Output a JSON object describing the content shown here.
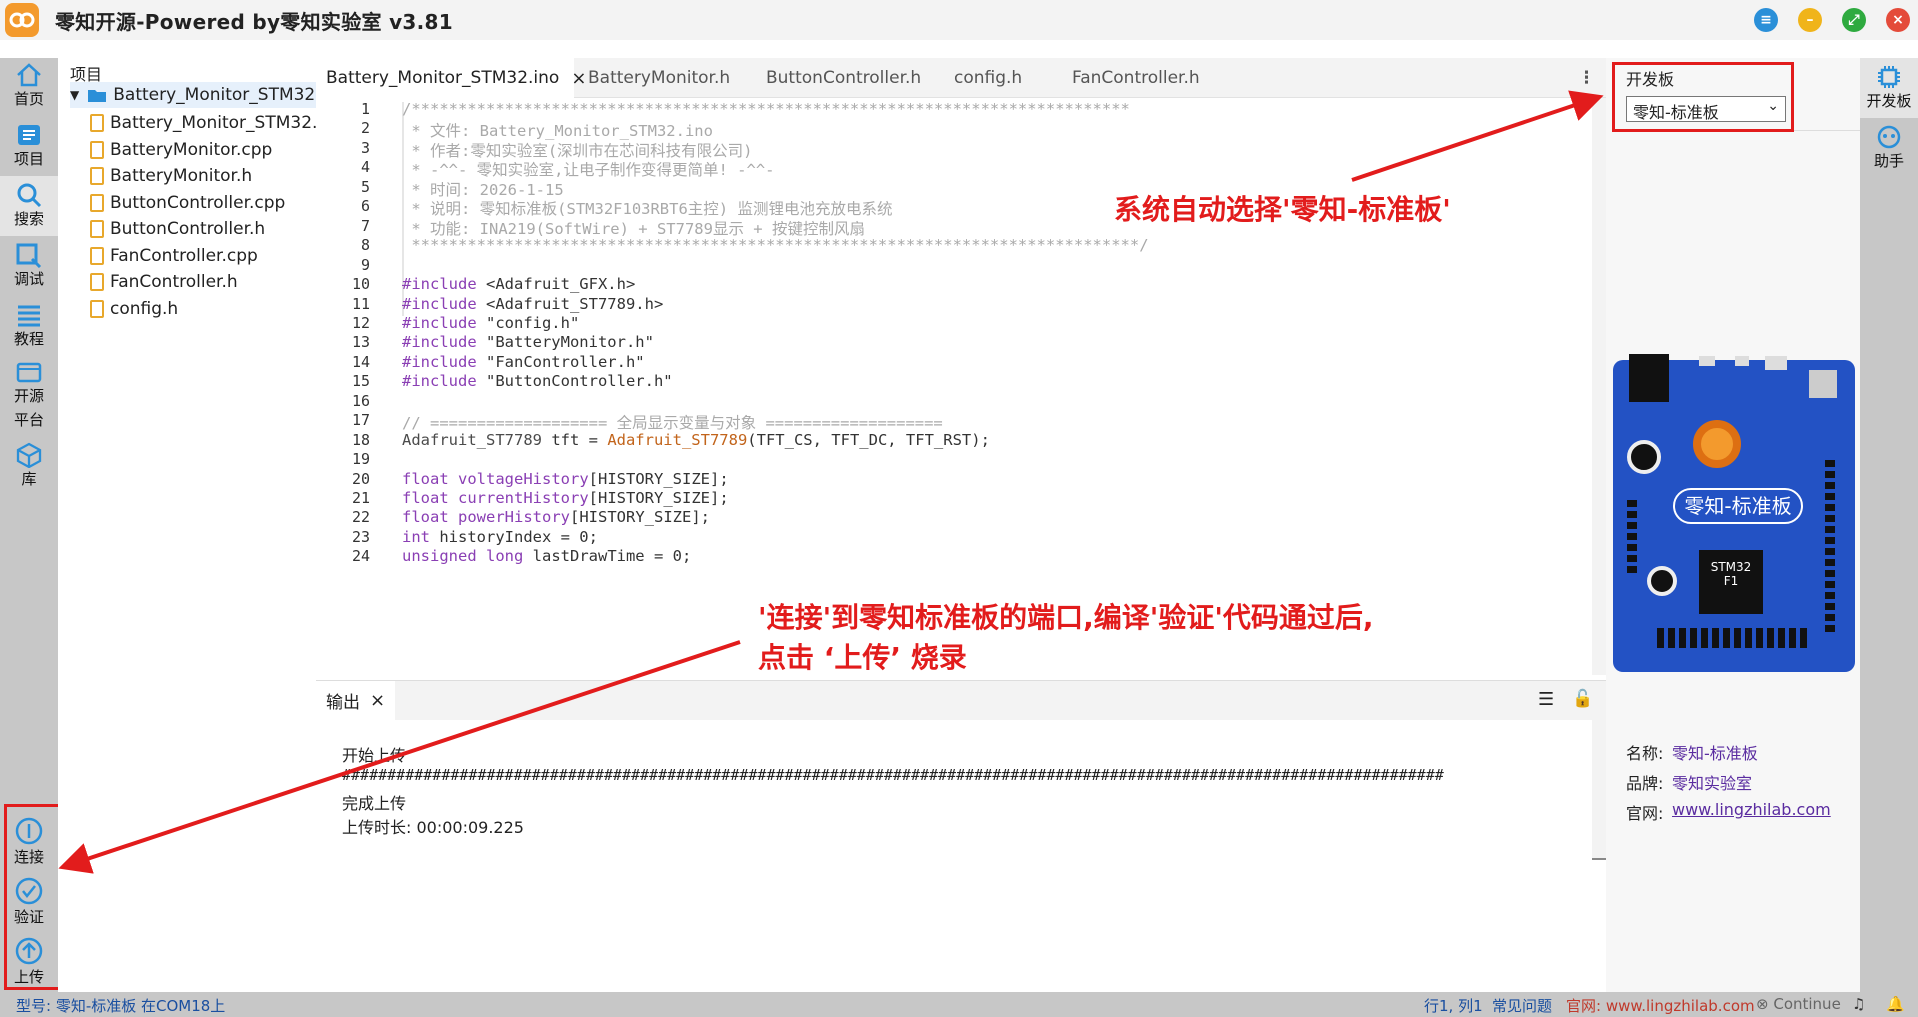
{
  "app": {
    "title": "零知开源-Powered by零知实验室 v3.81"
  },
  "leftbar": {
    "items": [
      {
        "label": "首页"
      },
      {
        "label": "项目"
      },
      {
        "label": "搜索"
      },
      {
        "label": "调试"
      },
      {
        "label": "教程"
      },
      {
        "label": "开源平台"
      },
      {
        "label": "库"
      }
    ],
    "bottom": [
      {
        "label": "连接"
      },
      {
        "label": "验证"
      },
      {
        "label": "上传"
      }
    ]
  },
  "project": {
    "header": "项目",
    "root": "Battery_Monitor_STM32",
    "files": [
      "Battery_Monitor_STM32.ino",
      "BatteryMonitor.cpp",
      "BatteryMonitor.h",
      "ButtonController.cpp",
      "ButtonController.h",
      "FanController.cpp",
      "FanController.h",
      "config.h"
    ]
  },
  "tabs": [
    {
      "label": "Battery_Monitor_STM32.ino",
      "active": true
    },
    {
      "label": "BatteryMonitor.h"
    },
    {
      "label": "ButtonController.h"
    },
    {
      "label": "config.h"
    },
    {
      "label": "FanController.h"
    }
  ],
  "code": {
    "lines": [
      "/*****************************************************************************",
      " * 文件: Battery_Monitor_STM32.ino",
      " * 作者:零知实验室(深圳市在芯间科技有限公司)",
      " * -^^- 零知实验室,让电子制作变得更简单! -^^-",
      " * 时间: 2026-1-15",
      " * 说明: 零知标准板(STM32F103RBT6主控) 监测锂电池充放电系统",
      " * 功能: INA219(SoftWire) + ST7789显示 + 按键控制风扇",
      " ******************************************************************************/",
      "",
      "#include <Adafruit_GFX.h>",
      "#include <Adafruit_ST7789.h>",
      "#include \"config.h\"",
      "#include \"BatteryMonitor.h\"",
      "#include \"FanController.h\"",
      "#include \"ButtonController.h\"",
      "",
      "// =================== 全局显示变量与对象 ===================",
      "Adafruit_ST7789 tft = Adafruit_ST7789(TFT_CS, TFT_DC, TFT_RST);",
      "",
      "float voltageHistory[HISTORY_SIZE];",
      "float currentHistory[HISTORY_SIZE];",
      "float powerHistory[HISTORY_SIZE];",
      "int historyIndex = 0;",
      "unsigned long lastDrawTime = 0;"
    ]
  },
  "output": {
    "tab": "输出",
    "lines": [
      "开始上传",
      "##########################################################################################################################",
      "完成上传",
      "上传时长: 00:00:09.225"
    ]
  },
  "board": {
    "header": "开发板",
    "selected": "零知-标准板",
    "image_label": "零知-标准板",
    "chip": "STM32\nF1",
    "name_label": "名称:",
    "name": "零知-标准板",
    "brand_label": "品牌:",
    "brand": "零知实验室",
    "site_label": "官网:",
    "site": "www.lingzhilab.com"
  },
  "rightbar": {
    "items": [
      {
        "label": "开发板"
      },
      {
        "label": "助手"
      }
    ]
  },
  "annotations": {
    "top": "系统自动选择'零知-标准板'",
    "bottom_line1": "'连接'到零知标准板的端口,编译'验证'代码通过后,",
    "bottom_line2": "点击 ‘上传’ 烧录"
  },
  "status": {
    "left": "型号: 零知-标准板 在COM18上",
    "pos": "行1, 列1",
    "faq": "常见问题",
    "site": "官网: www.lingzhilab.com",
    "continue": "Continue"
  }
}
